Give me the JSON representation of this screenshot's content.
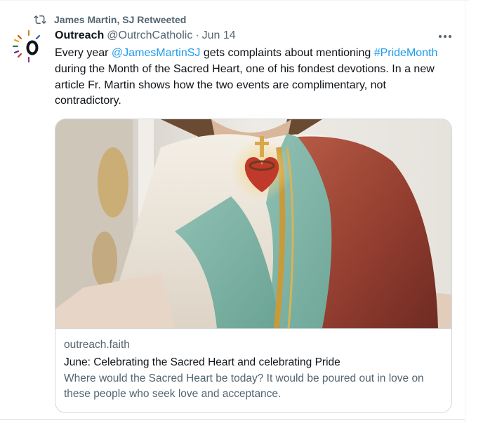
{
  "retweet": {
    "text": "James Martin, SJ Retweeted",
    "icon": "retweet-icon"
  },
  "tweet": {
    "author_name": "Outreach",
    "author_handle": "@OutrchCatholic",
    "separator": "·",
    "date": "Jun 14",
    "text_parts": {
      "p1": "Every year ",
      "mention": "@JamesMartinSJ",
      "p2": " gets complaints about mentioning ",
      "hashtag": "#PrideMonth",
      "p3": " during the Month of the Sacred Heart, one of his fondest devotions. In a new article Fr. Martin shows how the two events are complimentary, not contradictory."
    }
  },
  "card": {
    "domain": "outreach.faith",
    "title": "June: Celebrating the Sacred Heart and celebrating Pride",
    "description": "Where would the Sacred Heart be today?  It would be poured out in love on these people who seek love and acceptance."
  },
  "colors": {
    "accent": "#1d9bf0",
    "secondary_text": "#536471",
    "border": "#cfd9de"
  }
}
